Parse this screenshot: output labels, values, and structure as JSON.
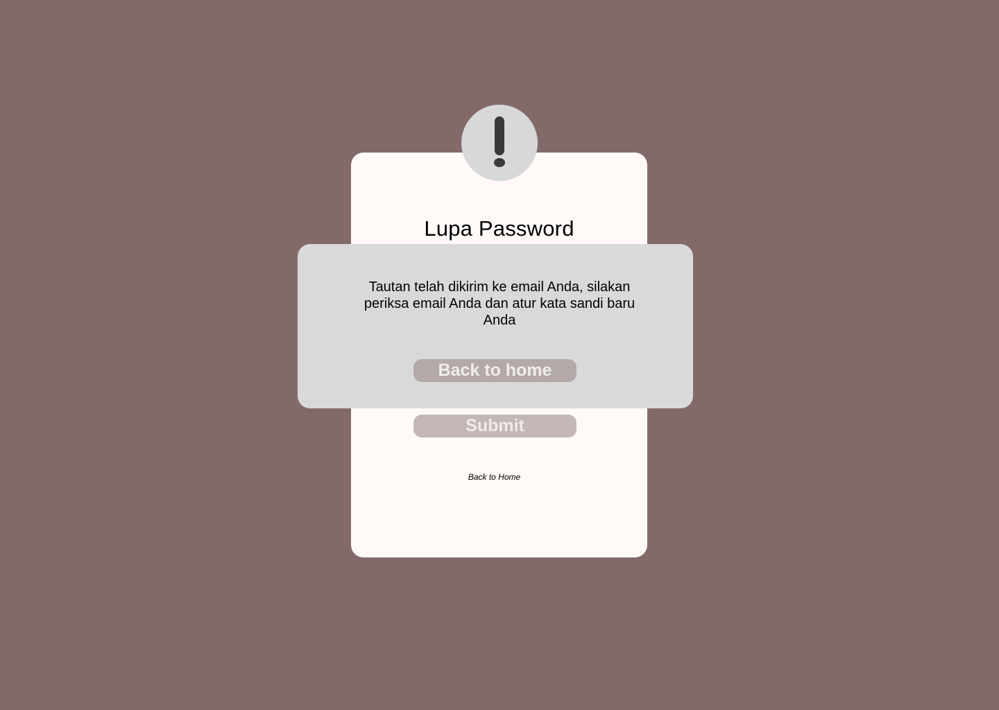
{
  "card": {
    "title": "Lupa Password",
    "submit_label": "Submit",
    "back_link_label": "Back to Home"
  },
  "alert_icon": {
    "icon": "exclamation-icon",
    "symbol": "!"
  },
  "dialog": {
    "message": "Tautan telah dikirim ke email Anda, silakan periksa email Anda dan atur kata sandi baru Anda",
    "button_label": "Back to home"
  },
  "colors": {
    "background": "#836a6a",
    "card": "#fffaf8",
    "dialog": "#d9d9d9",
    "icon_circle": "#d8d8d8",
    "icon_glyph": "#3a3a3a",
    "submit_button": "#c4b7b7",
    "dialog_button": "#b3a9a9",
    "button_text": "#f1ecec"
  }
}
